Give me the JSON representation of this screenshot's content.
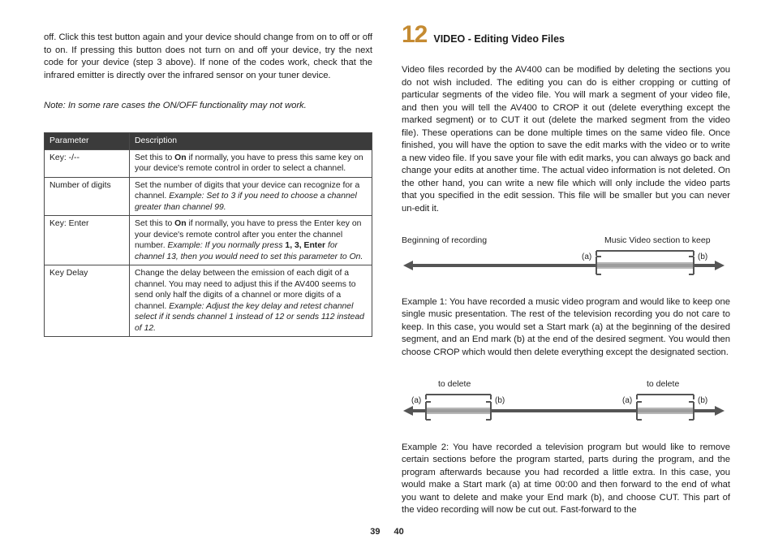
{
  "left_page": {
    "para1": "off. Click this test button again and your device should change from on to off or off to on. If pressing this button does not turn on and off your device, try the next code for your device (step 3 above). If none of the codes work, check that the infrared emitter is directly over the infrared sensor on your tuner device.",
    "note": "Note: In some rare cases the ON/OFF functionality may not work.",
    "table": {
      "head_param": "Parameter",
      "head_desc": "Description",
      "rows": [
        {
          "param": "Key: -/--",
          "desc_plain": "Set this to ",
          "desc_bold": "On",
          "desc_after": " if normally, you have to press this same key on your device's remote control in order to select a channel.",
          "desc_example": ""
        },
        {
          "param": "Number of digits",
          "desc_plain": "Set the number of digits that your device can recognize for a channel. ",
          "desc_bold": "",
          "desc_after": "",
          "desc_example": "Example: Set to 3 if you need to choose a channel greater than channel 99."
        },
        {
          "param": "Key: Enter",
          "desc_plain": "Set this to ",
          "desc_bold": "On",
          "desc_after": " if normally, you have to press the Enter key on your device's remote control after you enter the channel number. ",
          "desc_example": "Example: If you normally press ",
          "desc_example_bold": "1, 3, Enter",
          "desc_example_after": " for channel 13, then you would need to set this parameter to On."
        },
        {
          "param": "Key Delay",
          "desc_plain": "Change the delay between the emission of each digit of a channel. You may need to adjust this if the AV400 seems to send only half the digits of a channel or more digits of a channel. ",
          "desc_bold": "",
          "desc_after": "",
          "desc_example": "Example: Adjust the key delay and retest channel select if it sends channel 1 instead of 12 or sends 112 instead of 12."
        }
      ]
    },
    "page_no": "39"
  },
  "right_page": {
    "section_number": "12",
    "section_title": "VIDEO - Editing Video Files",
    "para1": "Video files recorded by the AV400 can be modified by deleting the sections you do not wish included. The editing you can do is either cropping or cutting of particular segments of the video file. You will mark a segment of your video file, and then you will tell the AV400 to CROP it out (delete everything except the marked segment) or to CUT it out (delete the marked segment from the video file). These operations can be done multiple times on the same video file. Once finished, you will have the option to save the edit marks with the video or to write a new video file. If you save your file with edit marks, you can always go back and change your edits at another time. The actual video information is not deleted. On the other hand, you can write a new file which will only include the video parts that you specified in the edit session. This file will be smaller but you can never un-edit it.",
    "diagram1": {
      "left_label": "Beginning of recording",
      "right_label": "Music Video section to keep",
      "a": "(a)",
      "b": "(b)"
    },
    "example1": "Example 1: You have recorded a music video program and would like to keep one single music presentation. The rest of the television recording you do not care to keep. In this case, you would set a Start mark (a) at the beginning of the desired segment, and an End mark (b) at the end of the desired segment. You would then choose CROP which would then delete everything except the designated section.",
    "diagram2": {
      "delete_left": "to delete",
      "delete_right": "to delete",
      "a": "(a)",
      "b": "(b)"
    },
    "example2": "Example 2: You have recorded a television program but would like to remove certain sections before the program started, parts during the program, and the program afterwards because you had recorded a little extra. In this case, you would make a Start mark (a) at time 00:00 and then forward to the end of what you want to delete and make your End mark (b), and choose CUT. This part of the video recording will now be cut out. Fast-forward to the",
    "page_no": "40"
  }
}
